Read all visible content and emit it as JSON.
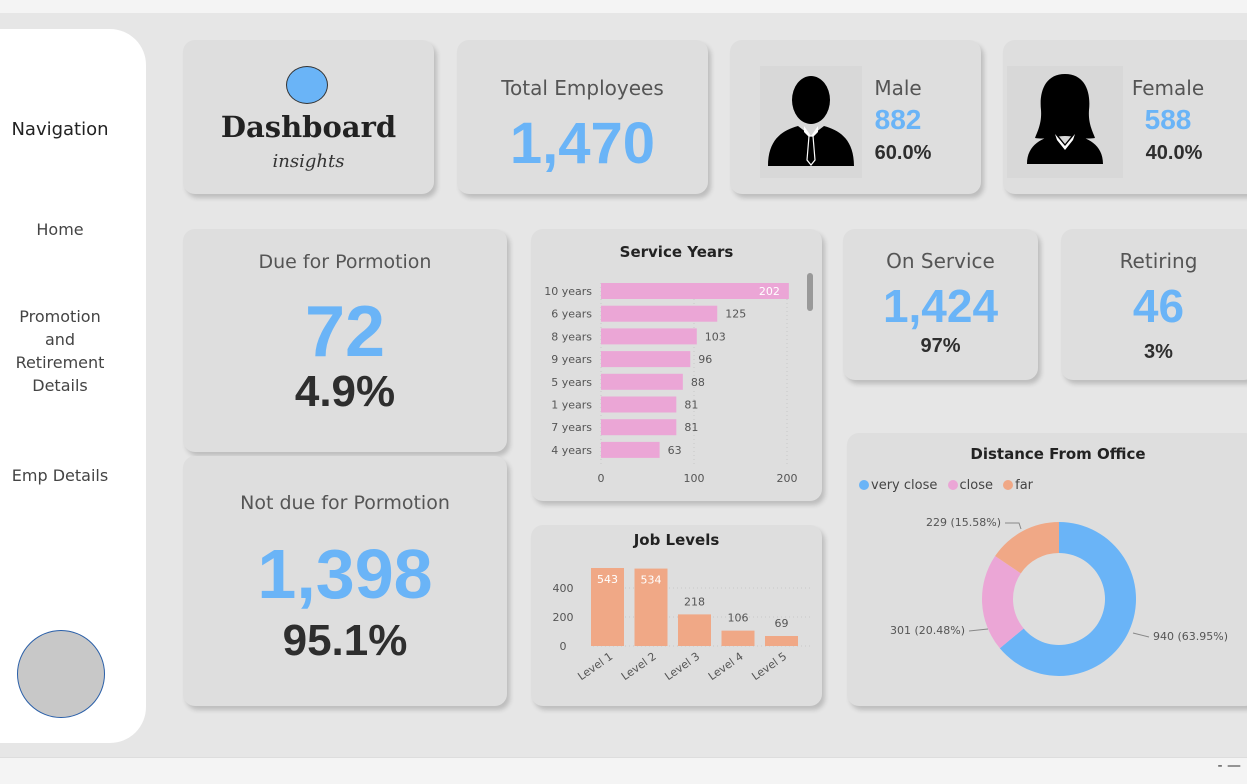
{
  "sidebar": {
    "title": "Navigation",
    "items": [
      "Home",
      "Promotion and Retirement Details",
      "Emp Details"
    ]
  },
  "header": {
    "title": "Dashboard",
    "subtitle": "insights"
  },
  "kpis": {
    "total": {
      "label": "Total Employees",
      "value": "1,470"
    },
    "male": {
      "label": "Male",
      "value": "882",
      "pct": "60.0%"
    },
    "female": {
      "label": "Female",
      "value": "588",
      "pct": "40.0%"
    },
    "due": {
      "label": "Due for Pormotion",
      "value": "72",
      "pct": "4.9%"
    },
    "not_due": {
      "label": "Not due for Pormotion",
      "value": "1,398",
      "pct": "95.1%"
    },
    "on_service": {
      "label": "On Service",
      "value": "1,424",
      "pct": "97%"
    },
    "retiring": {
      "label": "Retiring",
      "value": "46",
      "pct": "3%"
    }
  },
  "colors": {
    "accent_blue": "#6ab4f7",
    "pink": "#eba6d6",
    "orange": "#f0a886"
  },
  "icons": [
    "male-person-icon",
    "female-person-icon"
  ],
  "chart_data": [
    {
      "type": "bar",
      "orientation": "horizontal",
      "title": "Service Years",
      "categories": [
        "10 years",
        "6 years",
        "8 years",
        "9 years",
        "5 years",
        "1 years",
        "7 years",
        "4 years"
      ],
      "values": [
        202,
        125,
        103,
        96,
        88,
        81,
        81,
        63
      ],
      "xlim": [
        0,
        200
      ],
      "xticks": [
        "0",
        "100",
        "200"
      ],
      "color": "#eba6d6"
    },
    {
      "type": "bar",
      "title": "Job Levels",
      "categories": [
        "Level 1",
        "Level 2",
        "Level 3",
        "Level 4",
        "Level 5"
      ],
      "values": [
        543,
        534,
        218,
        106,
        69
      ],
      "ylim": [
        0,
        400
      ],
      "yticks": [
        "0",
        "200",
        "400"
      ],
      "color": "#f0a886"
    },
    {
      "type": "pie",
      "variant": "donut",
      "title": "Distance From Office",
      "legend_position": "top-left",
      "labels": [
        "very close",
        "close",
        "far"
      ],
      "values": [
        940,
        301,
        229
      ],
      "data_labels": [
        "940 (63.95%)",
        "301 (20.48%)",
        "229 (15.58%)"
      ],
      "colors": [
        "#6ab4f7",
        "#eba6d6",
        "#f0a886"
      ]
    }
  ]
}
